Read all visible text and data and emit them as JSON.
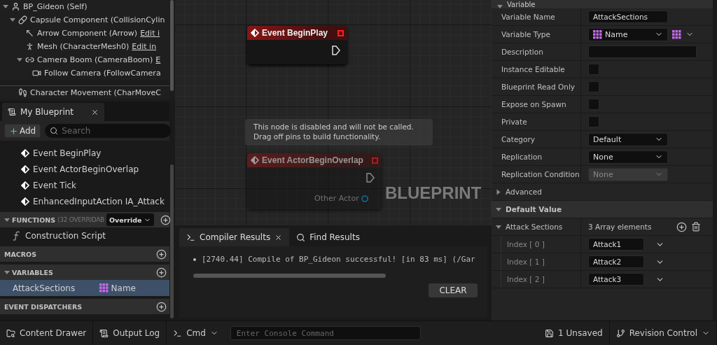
{
  "components": [
    {
      "label": "BP_Gideon (Self)",
      "kind": "self",
      "expanded": true,
      "children": [
        {
          "label": "Capsule Component (CollisionCylin",
          "kind": "capsule",
          "expanded": true,
          "children": [
            {
              "label": "Arrow Component (Arrow)",
              "kind": "arrow",
              "edit": "Edit i"
            },
            {
              "label": "Mesh (CharacterMesh0)",
              "kind": "mesh",
              "edit": "Edit in"
            },
            {
              "label": "Camera Boom (CameraBoom)",
              "kind": "boom",
              "edit": "E",
              "expanded": true,
              "children": [
                {
                  "label": "Follow Camera (FollowCamera",
                  "kind": "camera"
                }
              ]
            }
          ]
        },
        {
          "label": "Character Movement (CharMoveC",
          "kind": "movement",
          "divider": true
        }
      ]
    }
  ],
  "my_blueprint": {
    "tab": "My Blueprint",
    "add": "Add",
    "search": {
      "placeholder": "Search"
    },
    "events": [
      "Event BeginPlay",
      "Event ActorBeginOverlap",
      "Event Tick",
      "EnhancedInputAction IA_Attack"
    ],
    "sections": [
      {
        "title": "FUNCTIONS",
        "note": "(32 OVERRIDAB",
        "override": "Override",
        "expanded": true,
        "items": [
          {
            "label": "Construction Script",
            "kind": "function",
            "selected": false
          }
        ]
      },
      {
        "title": "MACROS"
      },
      {
        "title": "VARIABLES",
        "expanded": true,
        "items": [
          {
            "label": "AttackSections",
            "kind": "variable",
            "type": "Name",
            "selected": true
          }
        ]
      },
      {
        "title": "EVENT DISPATCHERS"
      }
    ]
  },
  "graph": {
    "nodes": [
      {
        "title": "Event BeginPlay",
        "disabled": false
      },
      {
        "title": "Event ActorBeginOverlap",
        "disabled": true,
        "pin": "Other Actor"
      }
    ],
    "comment": [
      "This node is disabled and will not be called.",
      "Drag off pins to build functionality."
    ],
    "watermark": "BLUEPRINT"
  },
  "results": {
    "tabs": [
      {
        "label": "Compiler Results",
        "selected": true
      },
      {
        "label": "Find Results",
        "selected": false
      }
    ],
    "lines": [
      "[2740.44] Compile of BP_Gideon successful! [in 83 ms] (/Gar"
    ],
    "clear": "CLEAR"
  },
  "details": {
    "section": "Variable",
    "rows": [
      {
        "label": "Variable Name",
        "kind": "text",
        "value": "AttackSections"
      },
      {
        "label": "Variable Type",
        "kind": "type",
        "value": "Name"
      },
      {
        "label": "Description",
        "kind": "text"
      },
      {
        "label": "Instance Editable",
        "kind": "checkbox",
        "checked": false
      },
      {
        "label": "Blueprint Read Only",
        "kind": "checkbox",
        "checked": false
      },
      {
        "label": "Expose on Spawn",
        "kind": "checkbox",
        "checked": false
      },
      {
        "label": "Private",
        "kind": "checkbox",
        "checked": false
      },
      {
        "label": "Category",
        "kind": "combo",
        "value": "Default"
      },
      {
        "label": "Replication",
        "kind": "dropdown",
        "value": "None",
        "disabled": false
      },
      {
        "label": "Replication Condition",
        "kind": "dropdown",
        "value": "None",
        "disabled": true
      }
    ],
    "advanced": {
      "label": "Advanced",
      "expanded": false
    },
    "default_value": {
      "title": "Default Value",
      "array": {
        "label": "Attack Sections",
        "count": "3 Array elements",
        "elements": [
          {
            "index": "Index [ 0 ]",
            "value": "Attack1"
          },
          {
            "index": "Index [ 1 ]",
            "value": "Attack2"
          },
          {
            "index": "Index [ 2 ]",
            "value": "Attack3"
          }
        ]
      }
    }
  },
  "status_bar": {
    "content_drawer": "Content Drawer",
    "output_log": "Output Log",
    "cmd": "Cmd",
    "console": {
      "placeholder": "Enter Console Command"
    },
    "unsaved": "1 Unsaved",
    "revision": "Revision Control"
  }
}
